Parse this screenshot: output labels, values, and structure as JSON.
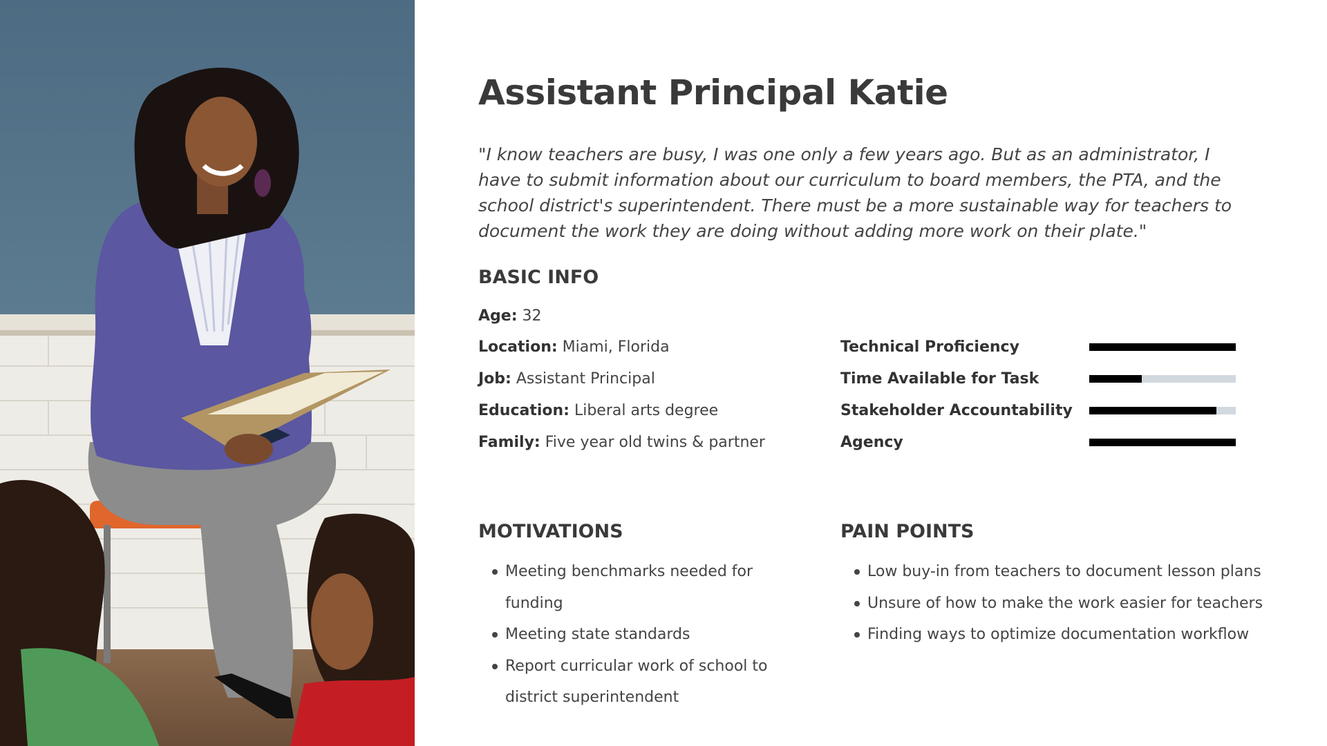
{
  "persona": {
    "name": "Assistant Principal Katie",
    "quote": "\"I know teachers are busy, I was one only a few years ago. But as an administrator, I have to submit information about our curriculum to board members, the PTA, and the school district's superintendent. There must be a more sustainable way for teachers to document the work they are doing without adding more work on their plate.\""
  },
  "basic_info": {
    "heading": "BASIC INFO",
    "rows": [
      {
        "key": "Age:",
        "value": "32"
      },
      {
        "key": "Location:",
        "value": "Miami, Florida"
      },
      {
        "key": "Job:",
        "value": "Assistant Principal"
      },
      {
        "key": "Education:",
        "value": "Liberal arts degree"
      },
      {
        "key": "Family:",
        "value": "Five year old twins & partner"
      }
    ]
  },
  "metrics": [
    {
      "label": "Technical Proficiency",
      "level": 1.0
    },
    {
      "label": "Time Available for Task",
      "level": 0.36
    },
    {
      "label": "Stakeholder Accountability",
      "level": 0.87
    },
    {
      "label": "Agency",
      "level": 1.0
    }
  ],
  "motivations": {
    "heading": "MOTIVATIONS",
    "items": [
      "Meeting benchmarks needed for funding",
      "Meeting state standards",
      "Report curricular work of school to district superintendent"
    ]
  },
  "pain_points": {
    "heading": "PAIN POINTS",
    "items": [
      "Low buy-in from teachers to document lesson plans",
      "Unsure of how to make the work easier for teachers",
      "Finding ways to optimize documentation workflow"
    ]
  },
  "colors": {
    "bar_fill": "#000000",
    "bar_track": "#d2d9de",
    "heading": "#3a3a3a"
  }
}
